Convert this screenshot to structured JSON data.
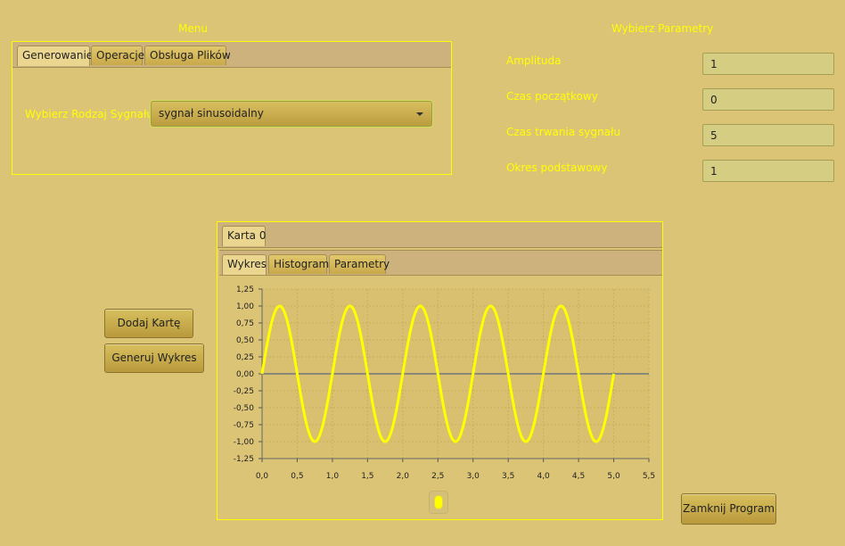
{
  "menu": {
    "title": "Menu",
    "tabs": [
      "Generowanie",
      "Operacje",
      "Obsługa Plików"
    ],
    "signal_type_label": "Wybierz Rodzaj Sygnału",
    "signal_type_value": "sygnał sinusoidalny"
  },
  "params": {
    "title": "Wybierz Parametry",
    "fields": [
      {
        "label": "Amplituda",
        "value": "1"
      },
      {
        "label": "Czas początkowy",
        "value": "0"
      },
      {
        "label": "Czas trwania sygnału",
        "value": "5"
      },
      {
        "label": "Okres podstawowy",
        "value": "1"
      }
    ]
  },
  "buttons": {
    "add_card": "Dodaj Kartę",
    "generate_chart": "Generuj Wykres",
    "close_program": "Zamknij Program"
  },
  "cards": {
    "outer_tab": "Karta 0",
    "inner_tabs": [
      "Wykres",
      "Histogram",
      "Parametry"
    ]
  },
  "colors": {
    "background": "#dcc477",
    "accent_yellow": "#ffff00",
    "series": "#ffff00"
  },
  "chart_data": {
    "type": "line",
    "title": "",
    "xlabel": "",
    "ylabel": "",
    "xlim": [
      0.0,
      5.5
    ],
    "ylim": [
      -1.25,
      1.25
    ],
    "x_ticks": [
      "0,0",
      "0,5",
      "1,0",
      "1,5",
      "2,0",
      "2,5",
      "3,0",
      "3,5",
      "4,0",
      "4,5",
      "5,0",
      "5,5"
    ],
    "y_ticks": [
      "1,25",
      "1,00",
      "0,75",
      "0,50",
      "0,25",
      "0,00",
      "-0,25",
      "-0,50",
      "-0,75",
      "-1,00",
      "-1,25"
    ],
    "grid": true,
    "series": [
      {
        "function": "amplitude * sin(2*pi*(t - start)/period)",
        "amplitude": 1,
        "start": 0,
        "duration": 5,
        "period": 1,
        "x_sample": [
          0,
          0.25,
          0.5,
          0.75,
          1.0,
          1.25,
          1.5,
          1.75,
          2.0,
          2.25,
          2.5,
          2.75,
          3.0,
          3.25,
          3.5,
          3.75,
          4.0,
          4.25,
          4.5,
          4.75,
          5.0
        ],
        "y_sample": [
          0,
          1,
          0,
          -1,
          0,
          1,
          0,
          -1,
          0,
          1,
          0,
          -1,
          0,
          1,
          0,
          -1,
          0,
          1,
          0,
          -1,
          0
        ]
      }
    ]
  }
}
